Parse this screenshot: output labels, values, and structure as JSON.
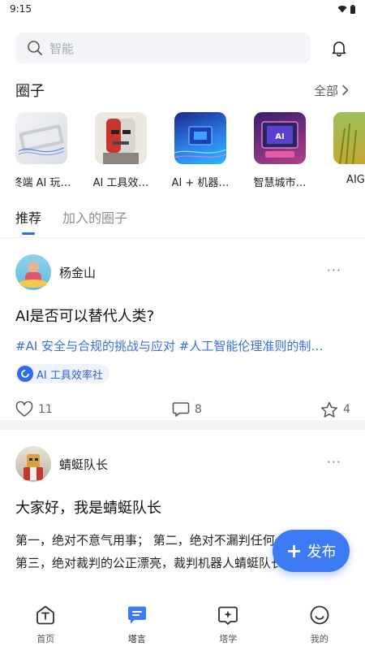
{
  "status_bar": {
    "time": "9:15",
    "wifi_icon": "wifi-icon",
    "battery_icon": "battery-icon"
  },
  "search": {
    "placeholder": "智能",
    "icon": "search-icon"
  },
  "header": {
    "bell_icon": "bell-icon"
  },
  "circles_section": {
    "title": "圈子",
    "see_all": "全部",
    "items": [
      {
        "label": "终端 AI 玩…"
      },
      {
        "label": "AI 工具效…"
      },
      {
        "label": "AI + 机器…"
      },
      {
        "label": "智慧城市…"
      },
      {
        "label": "AIGC"
      }
    ]
  },
  "tabs": [
    {
      "label": "推荐",
      "active": true
    },
    {
      "label": "加入的圈子",
      "active": false
    }
  ],
  "posts": [
    {
      "author": "杨金山",
      "more": "···",
      "title": "AI是否可以替代人类?",
      "tags": "#AI 安全与合规的挑战与应对 #人工智能伦理准则的制…",
      "circle": "AI 工具效率社",
      "likes": "11",
      "comments": "8",
      "favorites": "4"
    },
    {
      "author": "蜻蜓队长",
      "more": "···",
      "title": "大家好，我是蜻蜓队长",
      "body": "第一，绝对不意气用事； 第二，绝对不漏判任何一件坏事； 第三，绝对裁判的公正漂亮，裁判机器人蜻蜓队长前来觐见！"
    }
  ],
  "fab": {
    "label": "发布",
    "plus": "+"
  },
  "bottom_nav": [
    {
      "label": "首页",
      "icon": "home-icon",
      "active": false
    },
    {
      "label": "塔言",
      "icon": "chat-icon",
      "active": true
    },
    {
      "label": "塔学",
      "icon": "learn-icon",
      "active": false
    },
    {
      "label": "我的",
      "icon": "profile-icon",
      "active": false
    }
  ],
  "colors": {
    "accent": "#2f6bf0",
    "tag": "#3a6fe0",
    "fab": "#3d7bf5"
  }
}
